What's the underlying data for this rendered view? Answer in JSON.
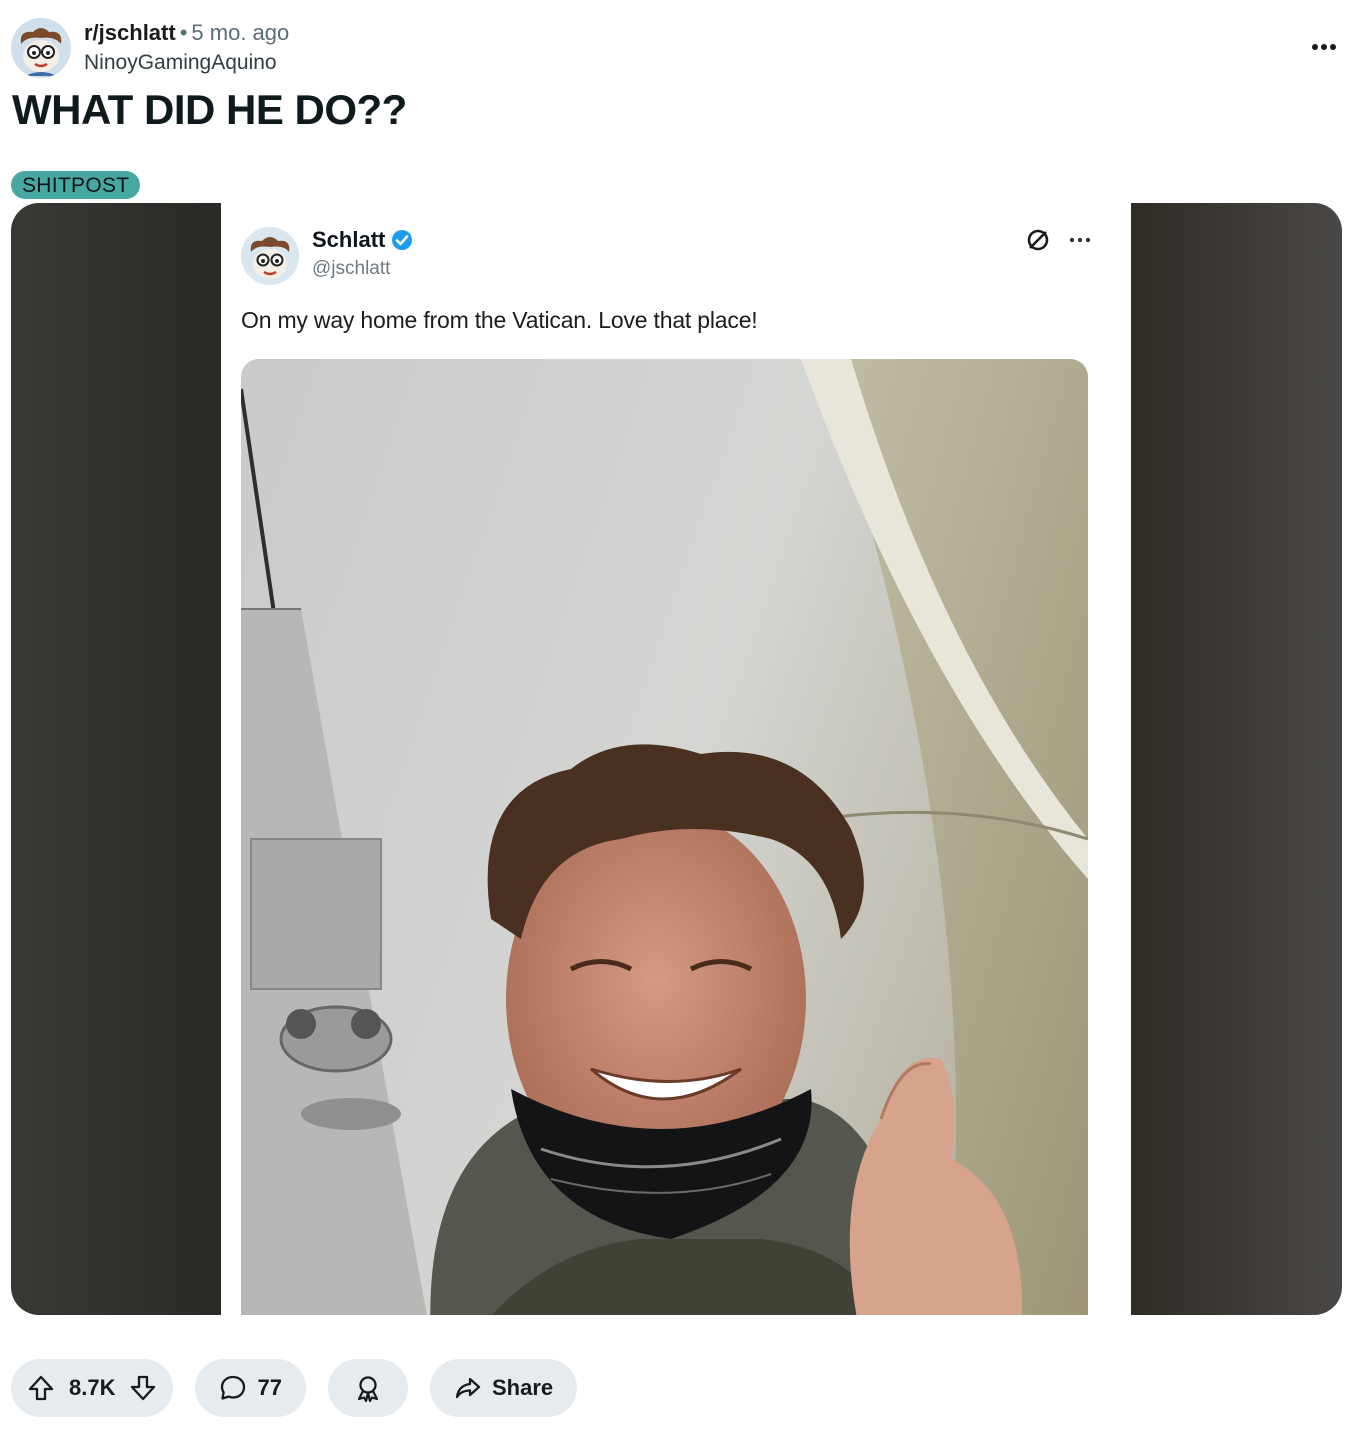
{
  "post": {
    "subreddit": "r/jschlatt",
    "separator": "•",
    "time_ago": "5 mo. ago",
    "author": "NinoyGamingAquino",
    "title": "WHAT DID HE DO??",
    "flair": "SHITPOST"
  },
  "tweet": {
    "display_name": "Schlatt",
    "handle": "@jschlatt",
    "text": "On my way home from the Vatican. Love that place!"
  },
  "actions": {
    "upvotes": "8.7K",
    "comments": "77",
    "share_label": "Share"
  },
  "colors": {
    "flair_bg": "#46a8a0",
    "pill_bg": "#e5ebee",
    "verified": "#1d9bf0"
  }
}
